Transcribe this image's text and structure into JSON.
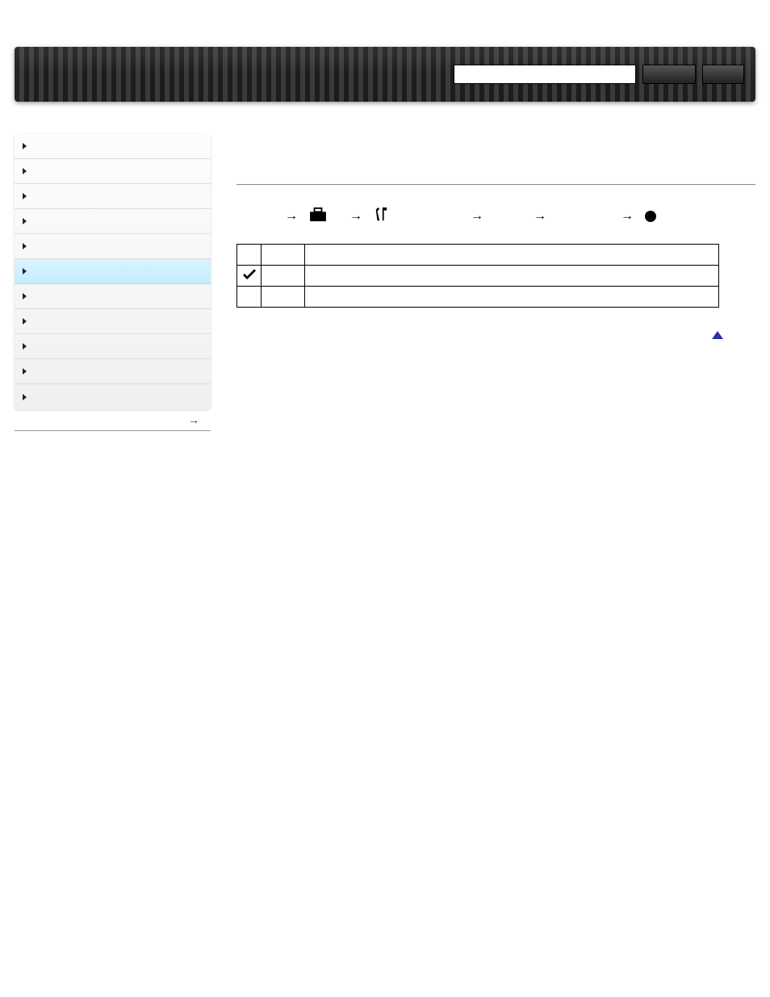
{
  "header": {
    "search_placeholder": "",
    "search_button": "",
    "reset_button": ""
  },
  "sidebar": {
    "items": [
      {
        "label": ""
      },
      {
        "label": ""
      },
      {
        "label": ""
      },
      {
        "label": ""
      },
      {
        "label": ""
      },
      {
        "label": ""
      },
      {
        "label": ""
      },
      {
        "label": ""
      },
      {
        "label": ""
      },
      {
        "label": ""
      },
      {
        "label": ""
      }
    ],
    "active_index": 5,
    "next_label": ""
  },
  "breadcrumb": {
    "steps": [
      "",
      "",
      "",
      "",
      ""
    ]
  },
  "table": {
    "headers": [
      "",
      "",
      ""
    ],
    "rows": [
      {
        "checked": true,
        "name": "",
        "desc": ""
      },
      {
        "checked": false,
        "name": "",
        "desc": ""
      }
    ]
  },
  "top_link_label": ""
}
